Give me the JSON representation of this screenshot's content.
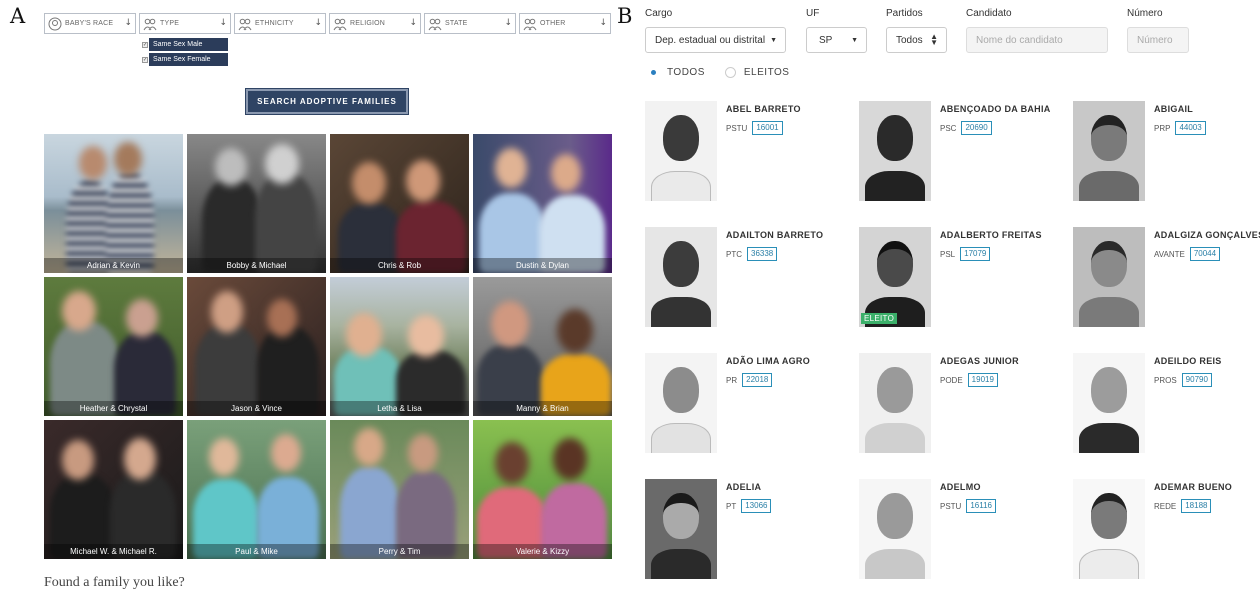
{
  "labels": {
    "a": "A",
    "b": "B"
  },
  "panel_a": {
    "filters": [
      {
        "label": "BABY'S RACE",
        "icon": "baby-icon"
      },
      {
        "label": "TYPE",
        "icon": "people-icon"
      },
      {
        "label": "ETHNICITY",
        "icon": "people-icon"
      },
      {
        "label": "RELIGION",
        "icon": "people-icon"
      },
      {
        "label": "STATE",
        "icon": "people-icon"
      },
      {
        "label": "OTHER",
        "icon": "people-icon"
      }
    ],
    "type_options": [
      "Same Sex Male",
      "Same Sex Female"
    ],
    "search_button": "SEARCH ADOPTIVE FAMILIES",
    "families": [
      "Adrian & Kevin",
      "Bobby & Michael",
      "Chris & Rob",
      "Dustin & Dylan",
      "Heather & Chrystal",
      "Jason & Vince",
      "Letha & Lisa",
      "Manny & Brian",
      "Michael W. & Michael R.",
      "Paul & Mike",
      "Perry & Tim",
      "Valerie & Kizzy"
    ],
    "footer_text": "Found a family you like?"
  },
  "panel_b": {
    "filters": {
      "cargo_label": "Cargo",
      "cargo_value": "Dep. estadual ou distrital",
      "uf_label": "UF",
      "uf_value": "SP",
      "partidos_label": "Partidos",
      "partidos_value": "Todos",
      "candidato_label": "Candidato",
      "candidato_placeholder": "Nome do candidato",
      "numero_label": "Número",
      "numero_placeholder": "Número"
    },
    "radios": {
      "todos": "TODOS",
      "eleitos": "ELEITOS",
      "selected": "todos"
    },
    "elected_badge": "ELEITO",
    "candidates": [
      {
        "name": "ABEL BARRETO",
        "party": "PSTU",
        "number": "16001",
        "elected": false
      },
      {
        "name": "ABENÇOADO DA BAHIA",
        "party": "PSC",
        "number": "20690",
        "elected": false
      },
      {
        "name": "ABIGAIL",
        "party": "PRP",
        "number": "44003",
        "elected": false
      },
      {
        "name": "ADAILTON BARRETO",
        "party": "PTC",
        "number": "36338",
        "elected": false
      },
      {
        "name": "ADALBERTO FREITAS",
        "party": "PSL",
        "number": "17079",
        "elected": true
      },
      {
        "name": "ADALGIZA GONÇALVES",
        "party": "AVANTE",
        "number": "70044",
        "elected": false
      },
      {
        "name": "ADÃO LIMA AGRO",
        "party": "PR",
        "number": "22018",
        "elected": false
      },
      {
        "name": "ADEGAS JUNIOR",
        "party": "PODE",
        "number": "19019",
        "elected": false
      },
      {
        "name": "ADEILDO REIS",
        "party": "PROS",
        "number": "90790",
        "elected": false
      },
      {
        "name": "ADELIA",
        "party": "PT",
        "number": "13066",
        "elected": false
      },
      {
        "name": "ADELMO",
        "party": "PSTU",
        "number": "16116",
        "elected": false
      },
      {
        "name": "ADEMAR BUENO",
        "party": "REDE",
        "number": "18188",
        "elected": false
      }
    ]
  }
}
